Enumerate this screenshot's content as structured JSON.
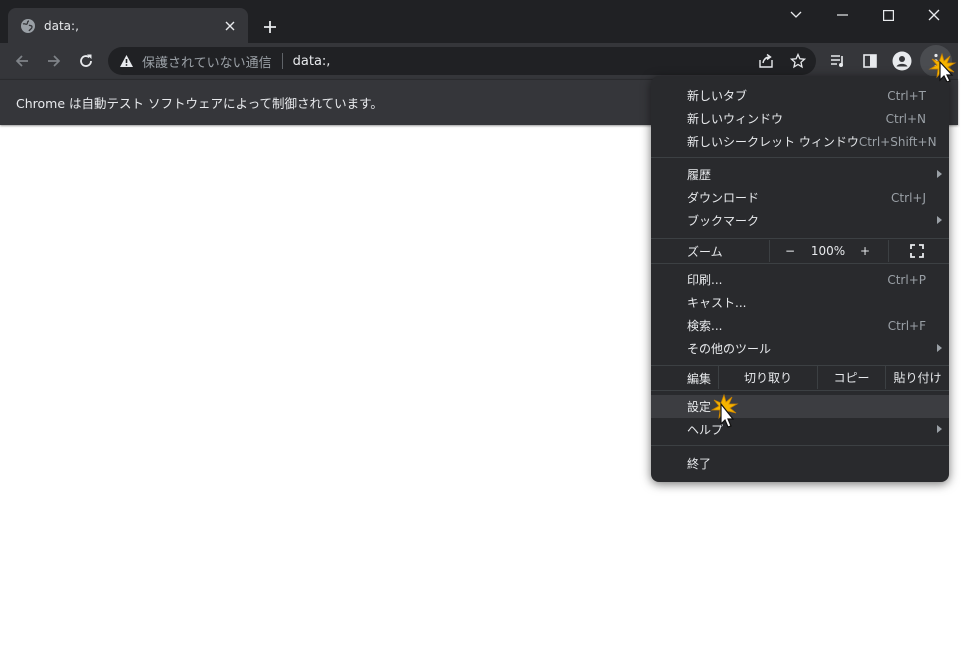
{
  "window": {
    "tab_title": "data:,",
    "colors": {
      "frame": "#202124",
      "toolbar": "#35363a",
      "menu": "#292a2d",
      "text": "#e8eaed",
      "muted": "#9aa0a6"
    }
  },
  "omnibox": {
    "security_text": "保護されていない通信",
    "url": "data:,"
  },
  "infobar": {
    "message": "Chrome は自動テスト ソフトウェアによって制御されています。"
  },
  "menu": {
    "items": [
      {
        "label": "新しいタブ",
        "shortcut": "Ctrl+T"
      },
      {
        "label": "新しいウィンドウ",
        "shortcut": "Ctrl+N"
      },
      {
        "label": "新しいシークレット ウィンドウ",
        "shortcut": "Ctrl+Shift+N"
      },
      {
        "label": "履歴",
        "shortcut": ""
      },
      {
        "label": "ダウンロード",
        "shortcut": "Ctrl+J"
      },
      {
        "label": "ブックマーク",
        "shortcut": ""
      },
      {
        "label": "印刷...",
        "shortcut": "Ctrl+P"
      },
      {
        "label": "キャスト...",
        "shortcut": ""
      },
      {
        "label": "検索...",
        "shortcut": "Ctrl+F"
      },
      {
        "label": "その他のツール",
        "shortcut": ""
      },
      {
        "label": "設定",
        "shortcut": ""
      },
      {
        "label": "ヘルプ",
        "shortcut": ""
      },
      {
        "label": "終了",
        "shortcut": ""
      }
    ],
    "zoom": {
      "label": "ズーム",
      "minus": "−",
      "value": "100%",
      "plus": "+"
    },
    "edit": {
      "label": "編集",
      "cut": "切り取り",
      "copy": "コピー",
      "paste": "貼り付け"
    }
  }
}
